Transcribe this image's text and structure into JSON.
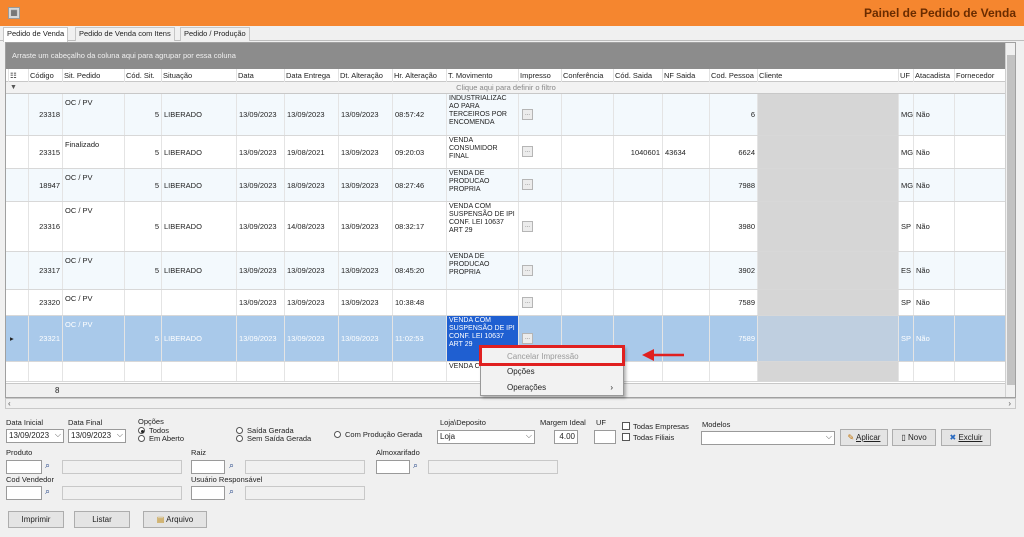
{
  "window": {
    "title": "Painel de Pedido de Venda"
  },
  "tabs": [
    "Pedido de Venda",
    "Pedido de Venda com Itens",
    "Pedido / Produção"
  ],
  "grid": {
    "group_hint": "Arraste um cabeçalho da coluna aqui para agrupar por essa coluna",
    "filter_hint": "Clique aqui para definir o filtro",
    "columns": [
      "Código",
      "Sit. Pedido",
      "Cód. Sit.",
      "Situação",
      "Data",
      "Data Entrega",
      "Dt. Alteração",
      "Hr. Alteração",
      "T. Movimento",
      "Impresso",
      "Conferência",
      "Cód. Saida",
      "NF Saida",
      "Cod. Pessoa",
      "Cliente",
      "UF",
      "Atacadista",
      "Fornecedor"
    ],
    "rows": [
      {
        "codigo": "23318",
        "sit_pedido": "OC / PV",
        "cod_sit": "5",
        "situacao": "LIBERADO",
        "data": "13/09/2023",
        "data_entrega": "13/09/2023",
        "dt_alteracao": "13/09/2023",
        "hr_alteracao": "08:57:42",
        "t_movimento": "INDUSTRIALIZAC AO PARA TERCEIROS POR ENCOMENDA",
        "impresso": "...",
        "cod_saida": "",
        "nf_saida": "",
        "cod_pessoa": "6",
        "uf": "MG",
        "atacadista": "Não"
      },
      {
        "codigo": "23315",
        "sit_pedido": "Finalizado",
        "cod_sit": "5",
        "situacao": "LIBERADO",
        "data": "13/09/2023",
        "data_entrega": "19/08/2021",
        "dt_alteracao": "13/09/2023",
        "hr_alteracao": "09:20:03",
        "t_movimento": "VENDA CONSUMIDOR FINAL",
        "impresso": "...",
        "cod_saida": "1040601",
        "nf_saida": "43634",
        "cod_pessoa": "6624",
        "uf": "MG",
        "atacadista": "Não"
      },
      {
        "codigo": "18947",
        "sit_pedido": "OC / PV",
        "cod_sit": "5",
        "situacao": "LIBERADO",
        "data": "13/09/2023",
        "data_entrega": "18/09/2023",
        "dt_alteracao": "13/09/2023",
        "hr_alteracao": "08:27:46",
        "t_movimento": "VENDA DE PRODUCAO PROPRIA",
        "impresso": "...",
        "cod_saida": "",
        "nf_saida": "",
        "cod_pessoa": "7988",
        "uf": "MG",
        "atacadista": "Não"
      },
      {
        "codigo": "23316",
        "sit_pedido": "OC / PV",
        "cod_sit": "5",
        "situacao": "LIBERADO",
        "data": "13/09/2023",
        "data_entrega": "14/08/2023",
        "dt_alteracao": "13/09/2023",
        "hr_alteracao": "08:32:17",
        "t_movimento": "VENDA COM SUSPENSÃO DE IPI CONF. LEI 10637 ART 29",
        "impresso": "...",
        "cod_saida": "",
        "nf_saida": "",
        "cod_pessoa": "3980",
        "uf": "SP",
        "atacadista": "Não"
      },
      {
        "codigo": "23317",
        "sit_pedido": "OC / PV",
        "cod_sit": "5",
        "situacao": "LIBERADO",
        "data": "13/09/2023",
        "data_entrega": "13/09/2023",
        "dt_alteracao": "13/09/2023",
        "hr_alteracao": "08:45:20",
        "t_movimento": "VENDA DE PRODUCAO PROPRIA",
        "impresso": "...",
        "cod_saida": "",
        "nf_saida": "",
        "cod_pessoa": "3902",
        "uf": "ES",
        "atacadista": "Não"
      },
      {
        "codigo": "23320",
        "sit_pedido": "OC / PV",
        "cod_sit": "",
        "situacao": "",
        "data": "13/09/2023",
        "data_entrega": "13/09/2023",
        "dt_alteracao": "13/09/2023",
        "hr_alteracao": "10:38:48",
        "t_movimento": "",
        "impresso": "...",
        "cod_saida": "",
        "nf_saida": "",
        "cod_pessoa": "7589",
        "uf": "SP",
        "atacadista": "Não"
      },
      {
        "codigo": "23321",
        "sit_pedido": "OC / PV",
        "cod_sit": "5",
        "situacao": "LIBERADO",
        "data": "13/09/2023",
        "data_entrega": "13/09/2023",
        "dt_alteracao": "13/09/2023",
        "hr_alteracao": "11:02:53",
        "t_movimento": "VENDA COM SUSPENSÃO DE IPI CONF. LEI 10637 ART 29",
        "impresso": "...",
        "cod_saida": "",
        "nf_saida": "",
        "cod_pessoa": "7589",
        "uf": "SP",
        "atacadista": "Não"
      },
      {
        "codigo": "",
        "sit_pedido": "",
        "cod_sit": "",
        "situacao": "",
        "data": "",
        "data_entrega": "",
        "dt_alteracao": "",
        "hr_alteracao": "",
        "t_movimento": "VENDA CO",
        "impresso": "",
        "cod_saida": "",
        "nf_saida": "",
        "cod_pessoa": "",
        "uf": "",
        "atacadista": ""
      }
    ],
    "footer_count": "8"
  },
  "context_menu": {
    "items": [
      "Cancelar Impressão",
      "Opções",
      "Operações"
    ],
    "highlight_color": "#e02020"
  },
  "filters": {
    "data_inicial_label": "Data Inicial",
    "data_inicial": "13/09/2023",
    "data_final_label": "Data Final",
    "data_final": "13/09/2023",
    "opcoes_label": "Opções",
    "opt_todos": "Todos",
    "opt_em_aberto": "Em Aberto",
    "opt_saida_gerada": "Saída Gerada",
    "opt_sem_saida_gerada": "Sem Saída Gerada",
    "opt_com_producao": "Com Produção Gerada",
    "loja_label": "Loja\\Deposito",
    "loja_value": "Loja",
    "margem_label": "Margem Ideal",
    "margem_value": "4.00",
    "uf_label": "UF",
    "todas_empresas": "Todas Empresas",
    "todas_filiais": "Todas Filiais",
    "modelos_label": "Modelos",
    "aplicar": "Aplicar",
    "novo": "Novo",
    "excluir": "Excluir",
    "produto_label": "Produto",
    "raiz_label": "Raiz",
    "almox_label": "Almoxarifado",
    "cod_vendedor_label": "Cod Vendedor",
    "usuario_resp_label": "Usuário Responsável",
    "imprimir": "Imprimir",
    "listar": "Listar",
    "arquivo": "Arquivo"
  }
}
